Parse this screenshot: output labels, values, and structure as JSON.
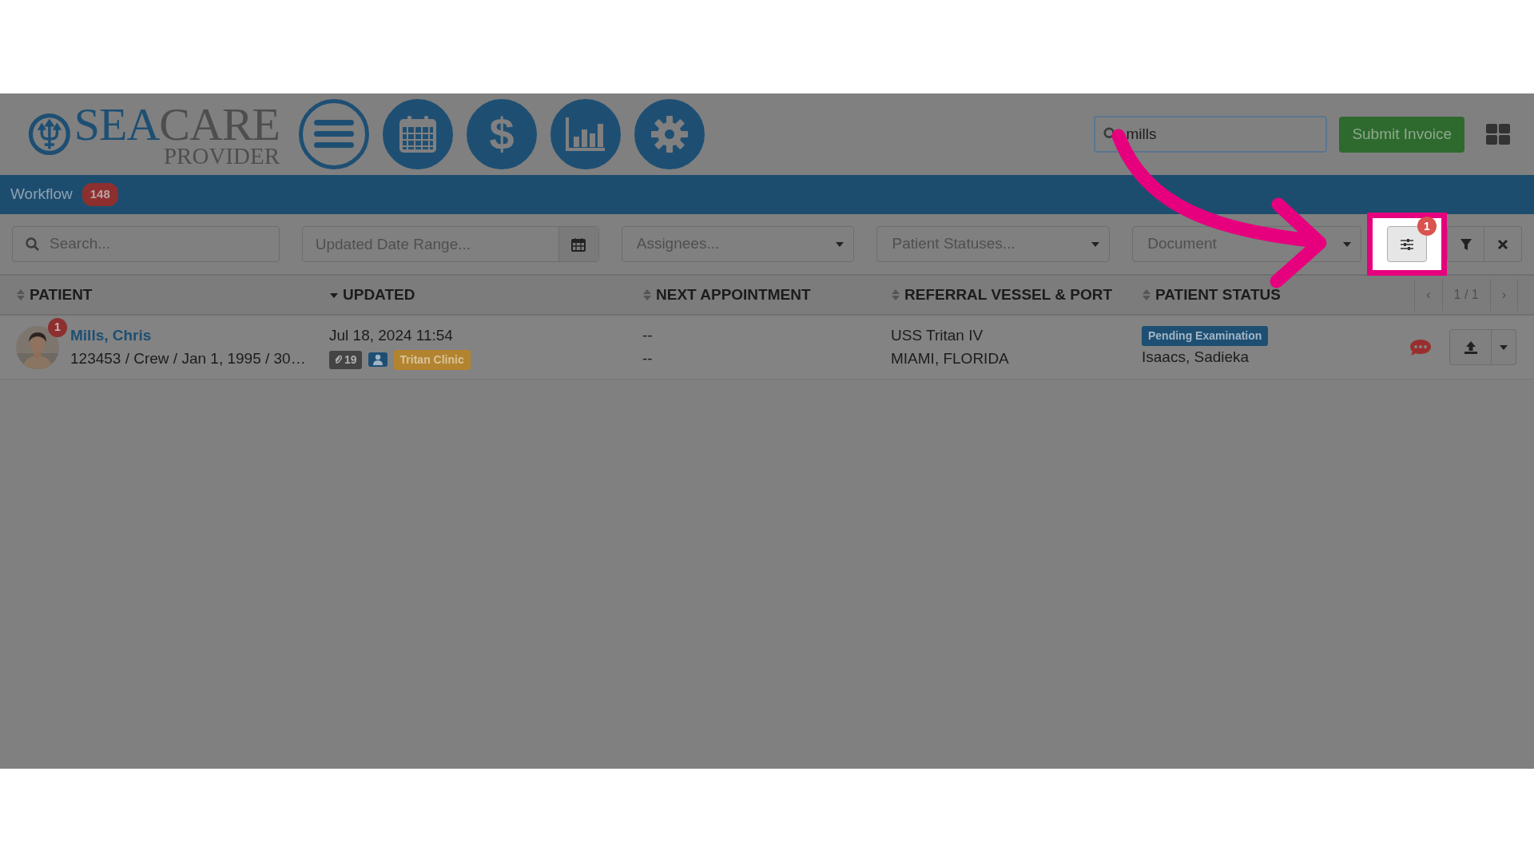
{
  "header": {
    "logo": {
      "name_part_1": "SEA",
      "name_part_2": "CARE",
      "subtitle": "PROVIDER"
    },
    "nav_buttons": [
      {
        "kind": "menu",
        "selected": true
      },
      {
        "kind": "calendar",
        "selected": false
      },
      {
        "kind": "currency",
        "label": "$",
        "selected": false
      },
      {
        "kind": "chart",
        "selected": false
      },
      {
        "kind": "settings",
        "selected": false
      }
    ],
    "search": {
      "value": "mills"
    },
    "submit_button": "Submit Invoice"
  },
  "nav_bar": {
    "title": "Workflow",
    "count": "148"
  },
  "filters": [
    {
      "kind": "search",
      "placeholder": "Search..."
    },
    {
      "kind": "date",
      "placeholder": "Updated Date Range..."
    },
    {
      "kind": "select",
      "placeholder": "Assignees..."
    },
    {
      "kind": "select",
      "placeholder": "Patient Statuses..."
    },
    {
      "kind": "select",
      "placeholder": "Document"
    }
  ],
  "filter_settings": {
    "count": "1",
    "highlighted": true
  },
  "table": {
    "columns": [
      {
        "label": "PATIENT",
        "sorted": false
      },
      {
        "label": "UPDATED",
        "sorted": true
      },
      {
        "label": "NEXT APPOINTMENT",
        "sorted": false
      },
      {
        "label": "REFERRAL VESSEL & PORT",
        "sorted": false
      },
      {
        "label": "PATIENT STATUS",
        "sorted": false
      }
    ],
    "pagination": {
      "prev": "‹",
      "pages": "1 / 1",
      "next": "›"
    },
    "rows": [
      {
        "name": "Mills, Chris",
        "notifications": "1",
        "details": "123453 / Crew / Jan 1, 1995 / 30…",
        "updated": "Jul 18, 2024 11:54",
        "attachments": "19",
        "clinic": "Tritan Clinic",
        "appointment": [
          "--",
          "--"
        ],
        "vessel": "USS Tritan IV",
        "port": "MIAMI, FLORIDA",
        "status": "Pending Examination",
        "assignee": "Isaacs, Sadieka"
      }
    ]
  }
}
